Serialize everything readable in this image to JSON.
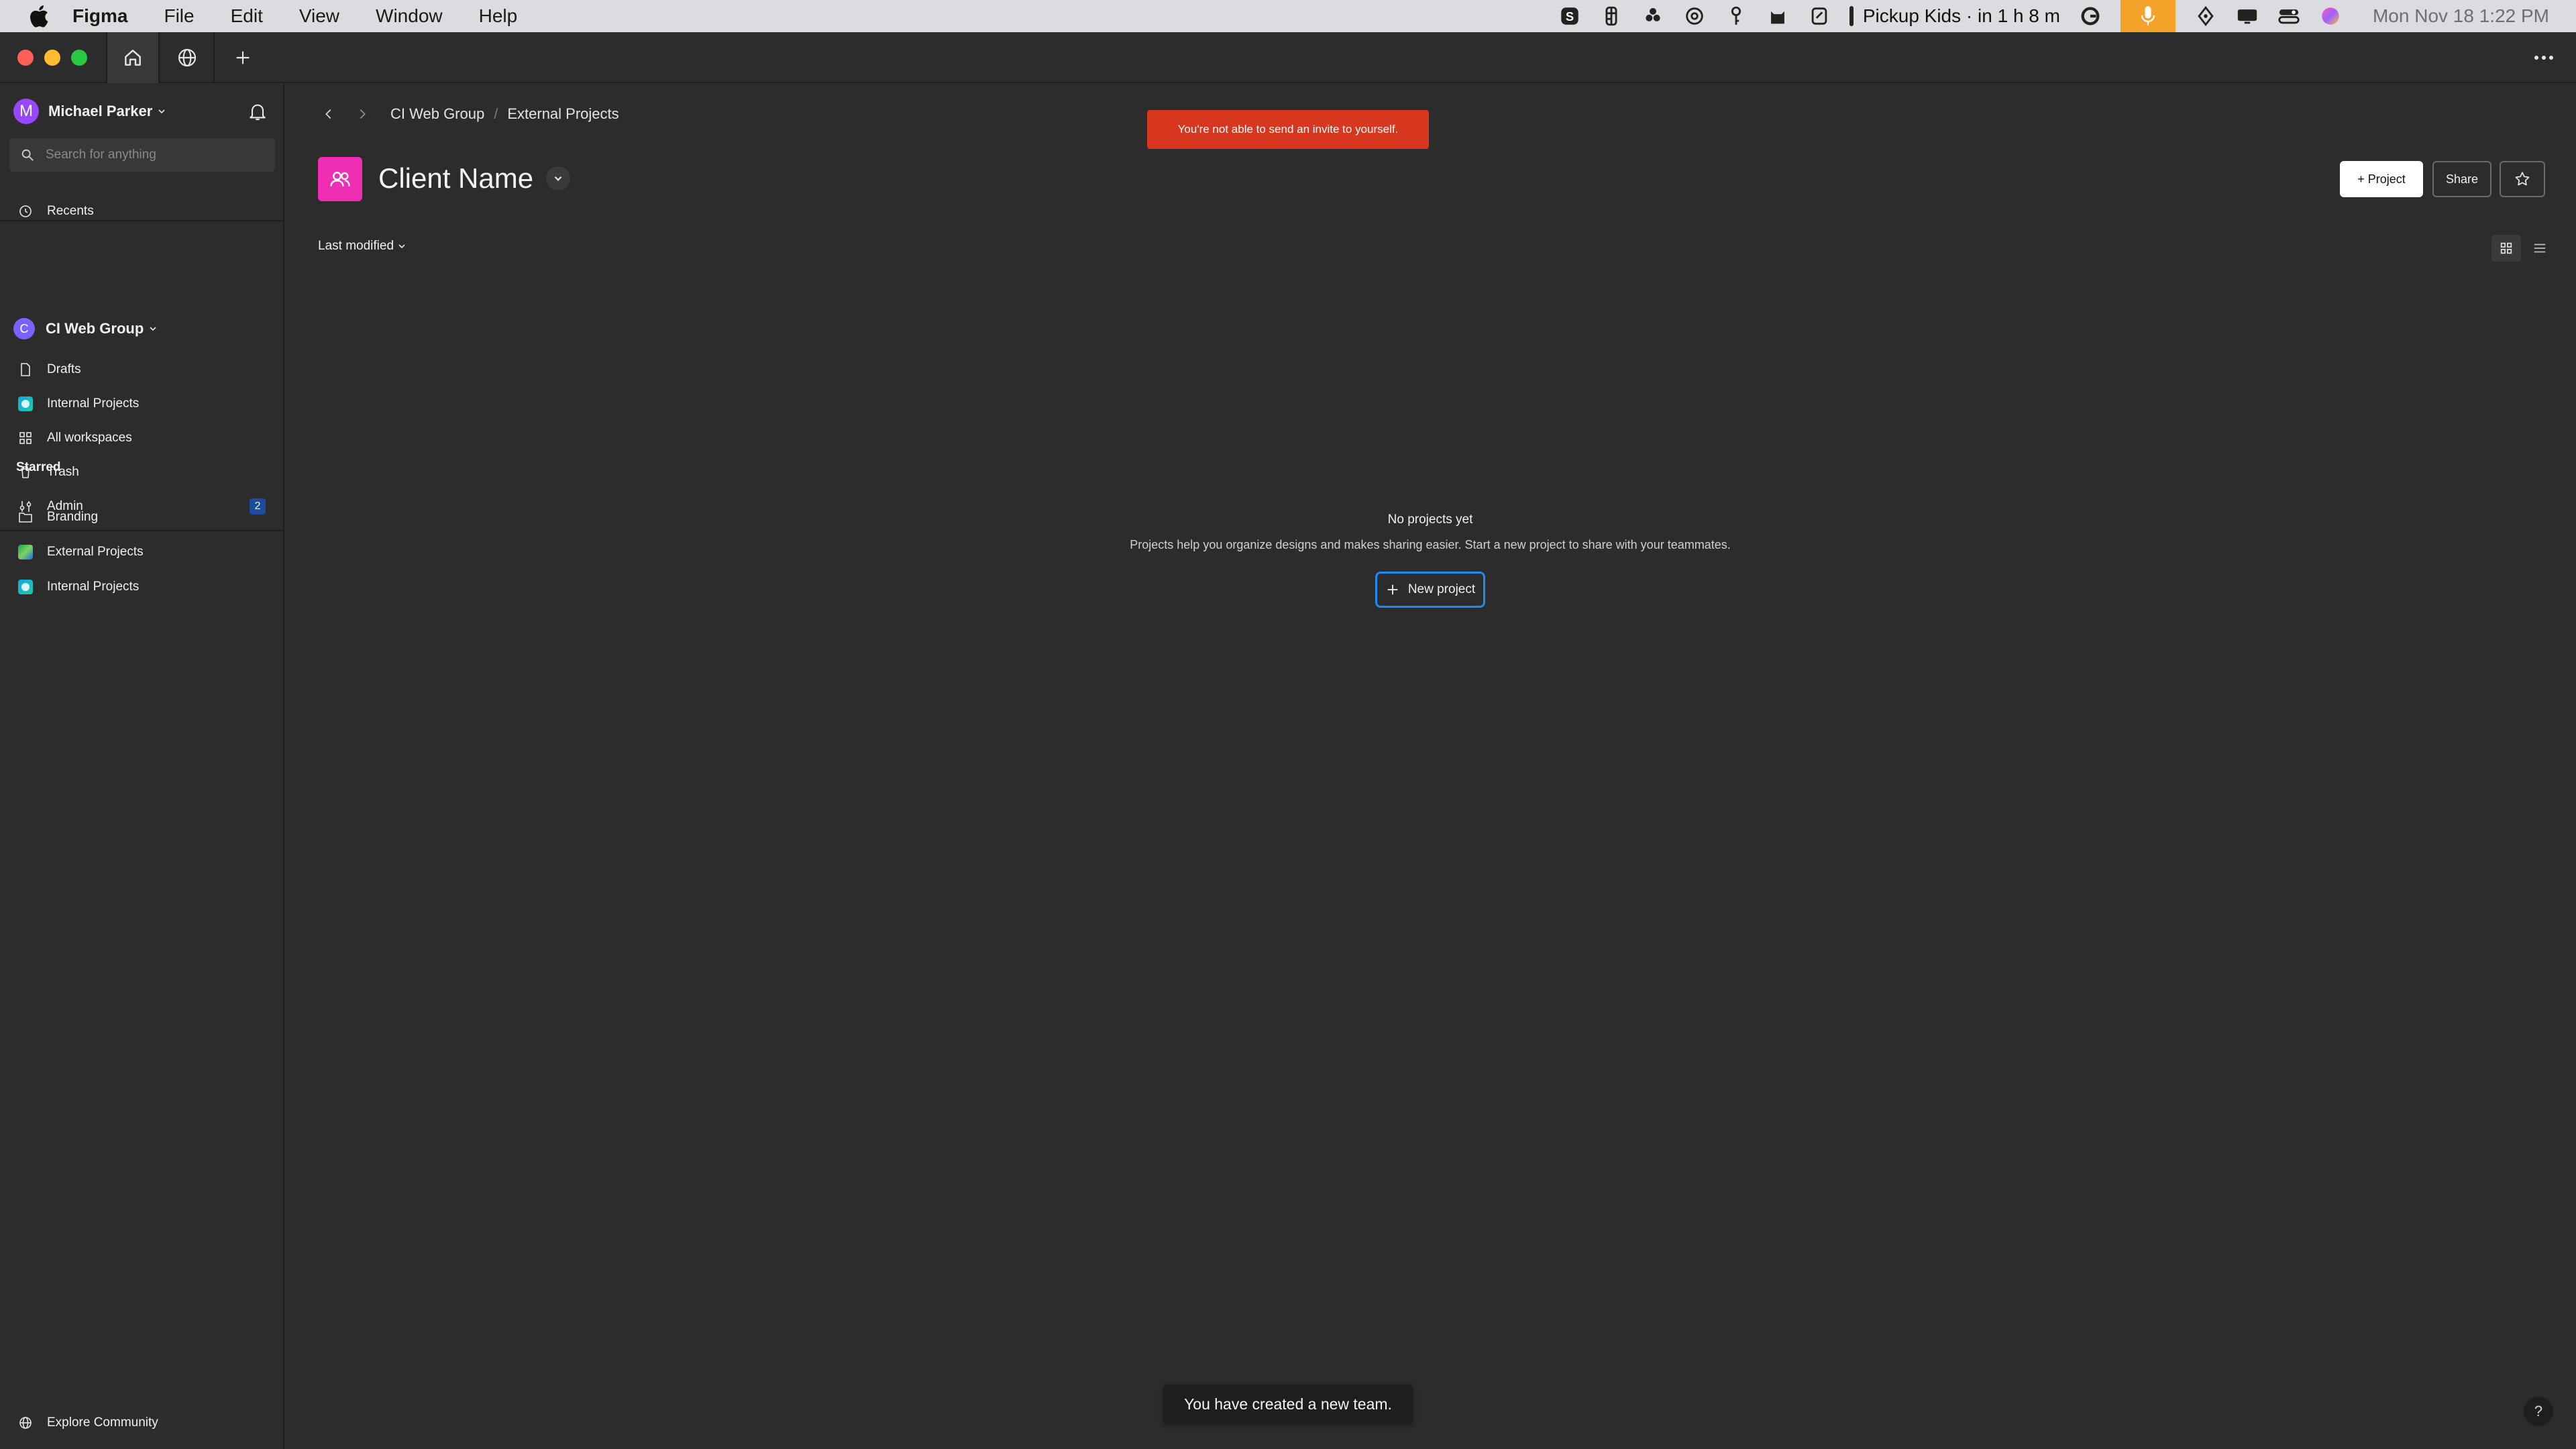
{
  "menubar": {
    "app_name": "Figma",
    "menus": [
      "File",
      "Edit",
      "View",
      "Window",
      "Help"
    ],
    "event_text": "Pickup Kids · in 1 h 8 m",
    "clock": "Mon Nov 18  1:22 PM"
  },
  "sidebar": {
    "user_name": "Michael Parker",
    "user_initial": "M",
    "search_placeholder": "Search for anything",
    "recents_label": "Recents",
    "team_name": "CI Web Group",
    "team_initial": "C",
    "items": [
      {
        "label": "Drafts",
        "icon": "file-icon"
      },
      {
        "label": "Internal Projects",
        "icon": "project-icon"
      },
      {
        "label": "All workspaces",
        "icon": "grid-icon"
      },
      {
        "label": "Trash",
        "icon": "trash-icon"
      },
      {
        "label": "Admin",
        "icon": "sliders-icon",
        "badge": "2"
      }
    ],
    "starred_label": "Starred",
    "starred": [
      {
        "label": "Branding",
        "icon": "folder-icon"
      },
      {
        "label": "External Projects",
        "icon": "project-icon"
      },
      {
        "label": "Internal Projects",
        "icon": "project-icon"
      }
    ],
    "explore_label": "Explore Community"
  },
  "main": {
    "breadcrumb": [
      "CI Web Group",
      "External Projects"
    ],
    "error_toast": "You're not able to send an invite to yourself.",
    "title": "Client Name",
    "project_button": "+ Project",
    "share_button": "Share",
    "sort_label": "Last modified",
    "empty_title": "No projects yet",
    "empty_desc": "Projects help you organize designs and makes sharing easier. Start a new project to share with your teammates.",
    "new_project_button": "New project",
    "success_toast": "You have created a new team.",
    "help_label": "?"
  },
  "colors": {
    "error": "#d7361f",
    "team_icon": "#ee2fb4",
    "accent": "#1d8cf0",
    "avatar_user": "#9747ff"
  }
}
